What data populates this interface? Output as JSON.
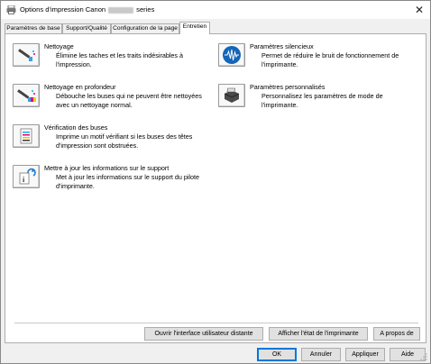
{
  "window": {
    "title_prefix": "Options d'impression Canon",
    "title_suffix": "series",
    "close_symbol": "✕"
  },
  "tabs": [
    {
      "label": "Paramètres de base"
    },
    {
      "label": "Support/Qualité"
    },
    {
      "label": "Configuration de la page"
    },
    {
      "label": "Entretien"
    }
  ],
  "maintenance": {
    "left": [
      {
        "title": "Nettoyage",
        "desc": [
          "Élimine les taches et les traits indésirables à",
          "l'impression."
        ],
        "icon": "printhead-cleaning-icon"
      },
      {
        "title": "Nettoyage en profondeur",
        "desc": [
          "Débouche les buses qui ne peuvent être nettoyées",
          "avec un nettoyage normal."
        ],
        "icon": "deep-cleaning-icon"
      },
      {
        "title": "Vérification des buses",
        "desc": [
          "Imprime un motif vérifiant si les buses des têtes",
          "d'impression sont obstruées."
        ],
        "icon": "nozzle-check-icon"
      },
      {
        "title": "Mettre à jour les informations sur le support",
        "desc": [
          "Met à jour les informations sur le support du pilote",
          "d'imprimante."
        ],
        "icon": "media-info-update-icon"
      }
    ],
    "right": [
      {
        "title": "Paramètres silencieux",
        "desc": [
          "Permet de réduire le bruit de fonctionnement de",
          "l'imprimante."
        ],
        "icon": "quiet-settings-icon"
      },
      {
        "title": "Paramètres personnalisés",
        "desc": [
          "Personnalisez les paramètres de mode de",
          "l'imprimante."
        ],
        "icon": "custom-settings-icon"
      }
    ]
  },
  "panel_buttons": {
    "remote_ui": "Ouvrir l'interface utilisateur distante",
    "printer_status": "Afficher l'état de l'imprimante",
    "about": "A propos de"
  },
  "dialog_buttons": {
    "ok": "OK",
    "cancel": "Annuler",
    "apply": "Appliquer",
    "help": "Aide"
  }
}
